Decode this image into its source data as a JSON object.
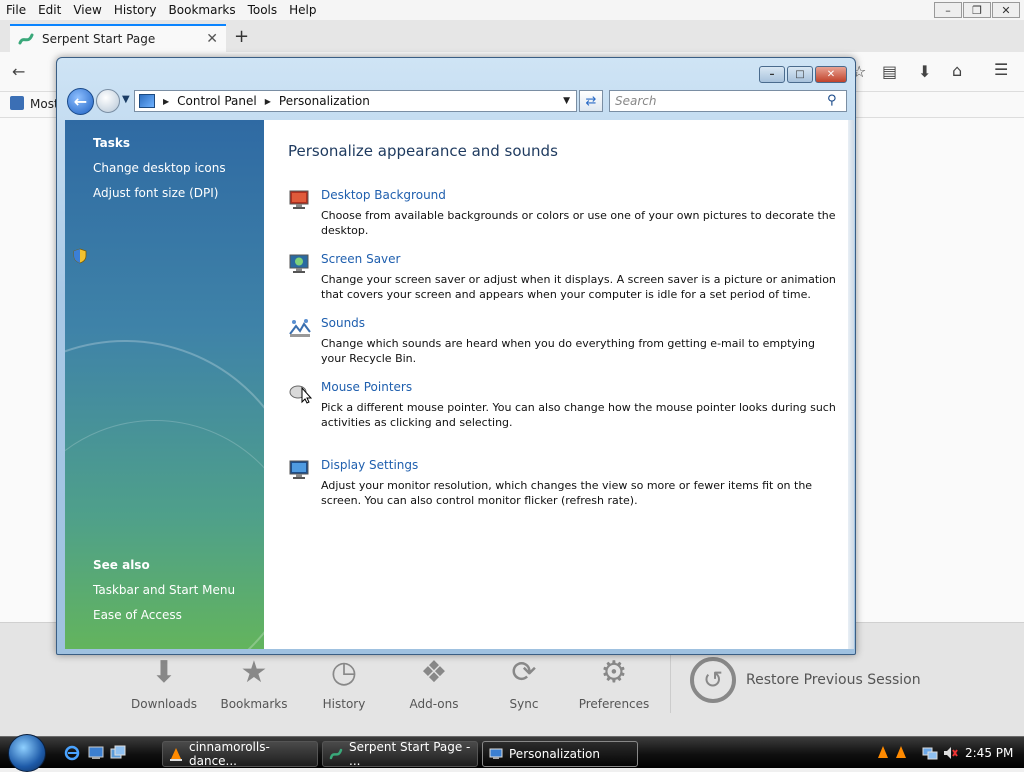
{
  "browser": {
    "menus": [
      "File",
      "Edit",
      "View",
      "History",
      "Bookmarks",
      "Tools",
      "Help"
    ],
    "tab_title": "Serpent Start Page",
    "bookmark_label": "Most",
    "launcher": [
      {
        "label": "Downloads",
        "icon": "download-icon"
      },
      {
        "label": "Bookmarks",
        "icon": "star-icon"
      },
      {
        "label": "History",
        "icon": "clock-icon"
      },
      {
        "label": "Add-ons",
        "icon": "puzzle-icon"
      },
      {
        "label": "Sync",
        "icon": "sync-icon"
      },
      {
        "label": "Preferences",
        "icon": "gear-icon"
      }
    ],
    "restore_label": "Restore Previous Session"
  },
  "window": {
    "breadcrumb": [
      "Control Panel",
      "Personalization"
    ],
    "search_placeholder": "Search",
    "left": {
      "tasks_heading": "Tasks",
      "tasks": [
        "Change desktop icons",
        "Adjust font size (DPI)"
      ],
      "see_also_heading": "See also",
      "see_also": [
        "Taskbar and Start Menu",
        "Ease of Access"
      ]
    },
    "title": "Personalize appearance and sounds",
    "items": [
      {
        "title": "Desktop Background",
        "icon": "desktop-background-icon",
        "desc": "Choose from available backgrounds or colors or use one of your own pictures to decorate the desktop."
      },
      {
        "title": "Screen Saver",
        "icon": "screen-saver-icon",
        "desc": "Change your screen saver or adjust when it displays. A screen saver is a picture or animation that covers your screen and appears when your computer is idle for a set period of time."
      },
      {
        "title": "Sounds",
        "icon": "sounds-icon",
        "desc": "Change which sounds are heard when you do everything from getting e-mail to emptying your Recycle Bin."
      },
      {
        "title": "Mouse Pointers",
        "icon": "mouse-pointer-icon",
        "desc": "Pick a different mouse pointer. You can also change how the mouse pointer looks during such activities as clicking and selecting."
      },
      {
        "title": "Display Settings",
        "icon": "display-settings-icon",
        "desc": "Adjust your monitor resolution, which changes the view so more or fewer items fit on the screen. You can also control monitor flicker (refresh rate)."
      }
    ]
  },
  "taskbar": {
    "buttons": [
      "cinnamorolls-dance...",
      "Serpent Start Page - ...",
      "Personalization"
    ],
    "clock": "2:45 PM"
  },
  "colors": {
    "link": "#1f5fae",
    "title": "#1e3a5f",
    "panel_top": "#2f6aa3",
    "panel_bottom": "#63b45d"
  }
}
